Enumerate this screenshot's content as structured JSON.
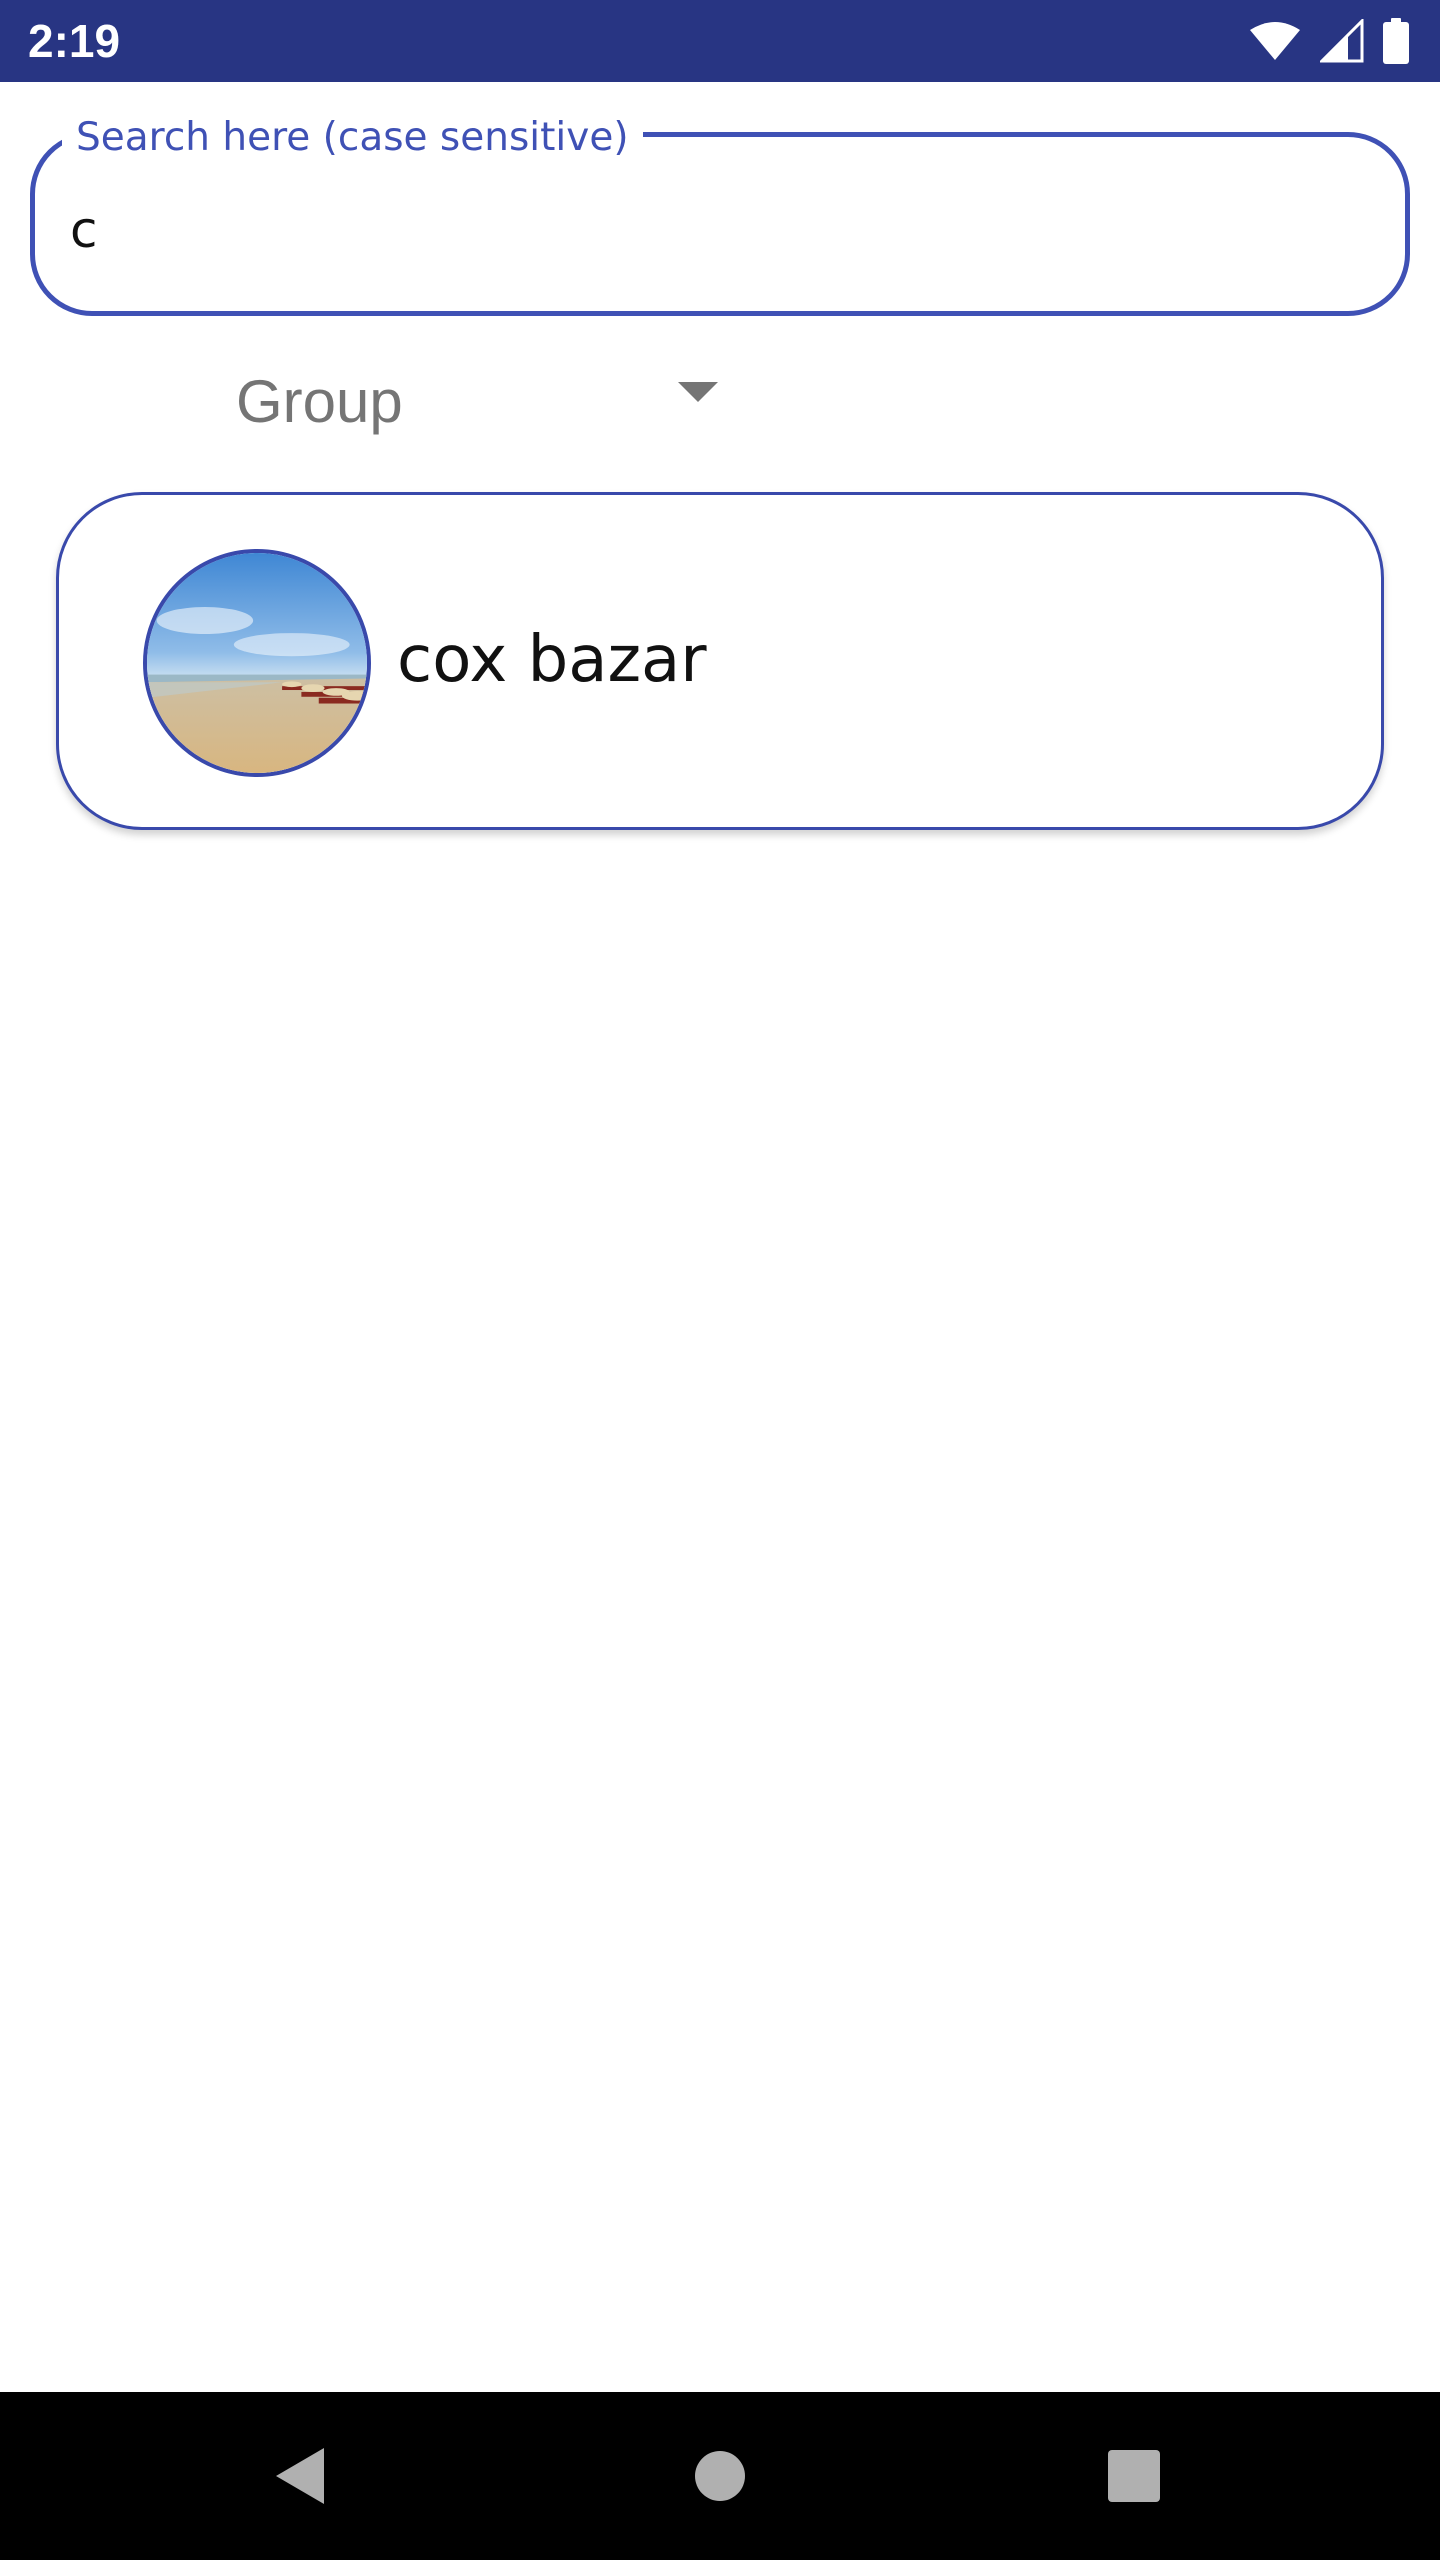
{
  "status_bar": {
    "time": "2:19",
    "icons": [
      "wifi-icon",
      "cell-signal-icon",
      "battery-icon"
    ]
  },
  "search": {
    "label": "Search here (case sensitive)",
    "value": "c"
  },
  "filter": {
    "selected": "Group",
    "icon": "dropdown-arrow-icon"
  },
  "results": [
    {
      "title": "cox bazar",
      "thumbnail": "beach-photo"
    }
  ],
  "nav_bar": {
    "icons": [
      "back-icon",
      "home-icon",
      "recents-icon"
    ]
  },
  "colors": {
    "status_bar": "#283583",
    "accent": "#3f51b5",
    "card_border": "#3949ab",
    "muted_text": "#757575",
    "nav_bar": "#000000"
  }
}
